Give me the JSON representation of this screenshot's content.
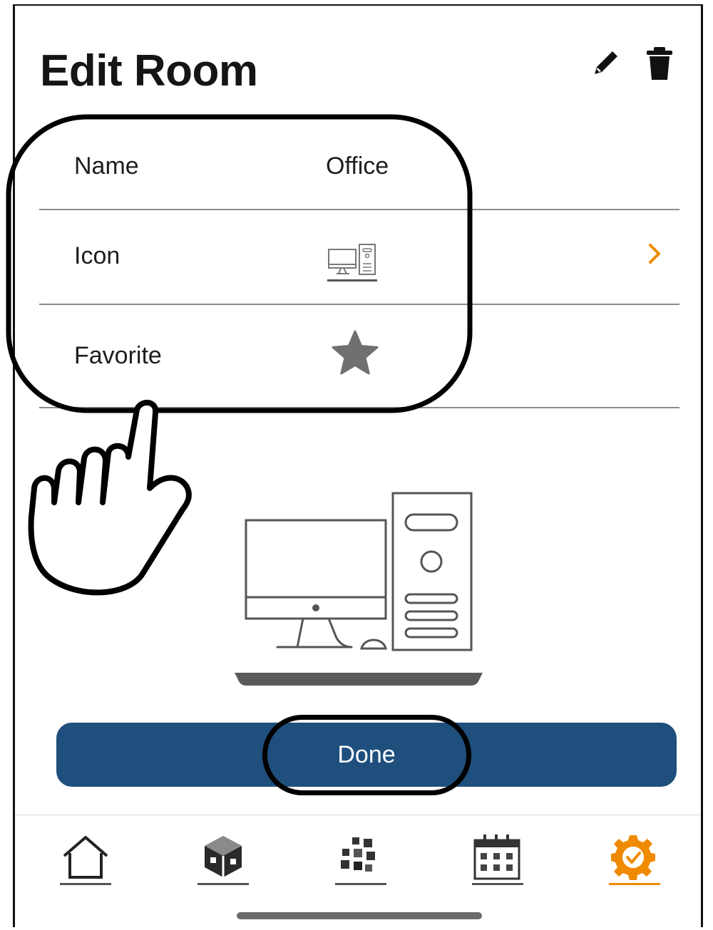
{
  "header": {
    "title": "Edit Room",
    "edit_icon": "pencil-icon",
    "delete_icon": "trash-icon"
  },
  "rows": [
    {
      "label": "Name",
      "value": "Office"
    },
    {
      "label": "Icon",
      "icon": "office-computer-icon",
      "chevron": "chevron-right-icon"
    },
    {
      "label": "Favorite",
      "icon": "star-icon"
    }
  ],
  "preview": {
    "icon": "office-computer-icon"
  },
  "done_button": {
    "label": "Done"
  },
  "tabbar": {
    "items": [
      {
        "id": "home",
        "icon": "home-icon",
        "active": false
      },
      {
        "id": "devices",
        "icon": "devices-cube-icon",
        "active": false
      },
      {
        "id": "scenes",
        "icon": "scenes-grid-icon",
        "active": false
      },
      {
        "id": "schedule",
        "icon": "calendar-icon",
        "active": false
      },
      {
        "id": "settings",
        "icon": "settings-gear-icon",
        "active": true
      }
    ]
  },
  "colors": {
    "accent": "#f08a00",
    "primary": "#1f4f7d",
    "divider": "#8a8a8a"
  }
}
